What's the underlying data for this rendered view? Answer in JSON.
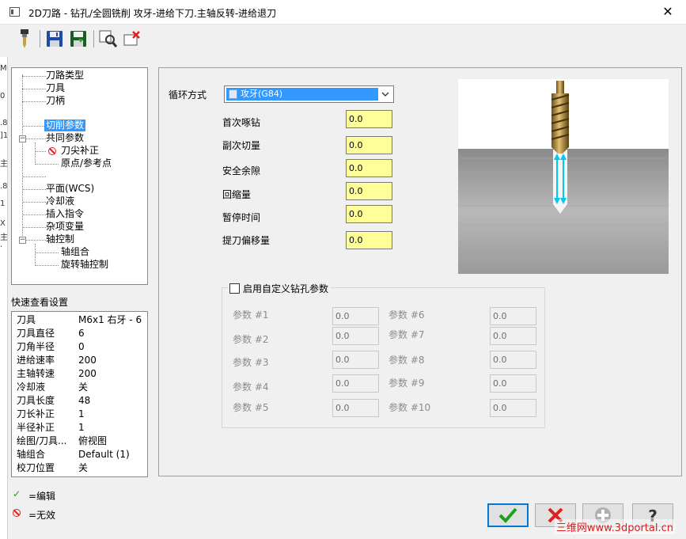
{
  "window": {
    "title": "2D刀路 - 钻孔/全圆铣削 攻牙-进给下刀.主轴反转-进给退刀",
    "close_glyph": "✕"
  },
  "toolbar": {
    "icons": [
      "tool-icon",
      "save-icon",
      "save-as-icon",
      "view-icon",
      "delete-icon"
    ]
  },
  "left_window_edge": [
    "MI",
    "0",
    "]1",
    ".8",
    "主",
    ".8",
    "1",
    "X",
    "主",
    "."
  ],
  "tree": {
    "items": [
      "刀路类型",
      "刀具",
      "刀柄",
      "切削参数",
      "共同参数",
      "刀尖补正",
      "原点/参考点",
      "平面(WCS)",
      "冷却液",
      "插入指令",
      "杂项变量",
      "轴控制",
      "轴组合",
      "旋转轴控制"
    ],
    "collapse_glyph": "−"
  },
  "quick_view": {
    "title": "快速查看设置",
    "rows": [
      {
        "k": "刀具",
        "v": "M6x1 右牙 - 6"
      },
      {
        "k": "刀具直径",
        "v": "6"
      },
      {
        "k": "刀角半径",
        "v": "0"
      },
      {
        "k": "进给速率",
        "v": "200"
      },
      {
        "k": "主轴转速",
        "v": "200"
      },
      {
        "k": "冷却液",
        "v": "关"
      },
      {
        "k": "刀具长度",
        "v": "48"
      },
      {
        "k": "刀长补正",
        "v": "1"
      },
      {
        "k": "半径补正",
        "v": "1"
      },
      {
        "k": "绘图/刀具...",
        "v": "俯视图"
      },
      {
        "k": "轴组合",
        "v": "Default (1)"
      },
      {
        "k": "校刀位置",
        "v": "关"
      }
    ]
  },
  "legend": {
    "edit_glyph": "✓",
    "edit_label": "=编辑",
    "disabled_label": "=无效"
  },
  "cutting": {
    "cycle_label": "循环方式",
    "cycle_value": "攻牙(G84)",
    "params": [
      {
        "label": "首次啄钻",
        "value": "0.0"
      },
      {
        "label": "副次切量",
        "value": "0.0"
      },
      {
        "label": "安全余隙",
        "value": "0.0"
      },
      {
        "label": "回缩量",
        "value": "0.0"
      },
      {
        "label": "暂停时间",
        "value": "0.0"
      },
      {
        "label": "提刀偏移量",
        "value": "0.0"
      }
    ]
  },
  "custom": {
    "checkbox_label": "启用自定义钻孔参数",
    "checked": false,
    "params": [
      {
        "label": "参数 #1",
        "value": "0.0"
      },
      {
        "label": "参数 #2",
        "value": "0.0"
      },
      {
        "label": "参数 #3",
        "value": "0.0"
      },
      {
        "label": "参数 #4",
        "value": "0.0"
      },
      {
        "label": "参数 #5",
        "value": "0.0"
      },
      {
        "label": "参数 #6",
        "value": "0.0"
      },
      {
        "label": "参数 #7",
        "value": "0.0"
      },
      {
        "label": "参数 #8",
        "value": "0.0"
      },
      {
        "label": "参数 #9",
        "value": "0.0"
      },
      {
        "label": "参数 #10",
        "value": "0.0"
      }
    ]
  },
  "buttons": [
    "ok-button",
    "cancel-button",
    "add-button",
    "help-button"
  ],
  "colors": {
    "selection": "#3399ff",
    "field_bg": "#ffff99",
    "ok_green": "#1aa21a",
    "cancel_red": "#e02020",
    "arrow_cyan": "#00c8f0"
  },
  "watermark": "三维网www.3dportal.cn"
}
